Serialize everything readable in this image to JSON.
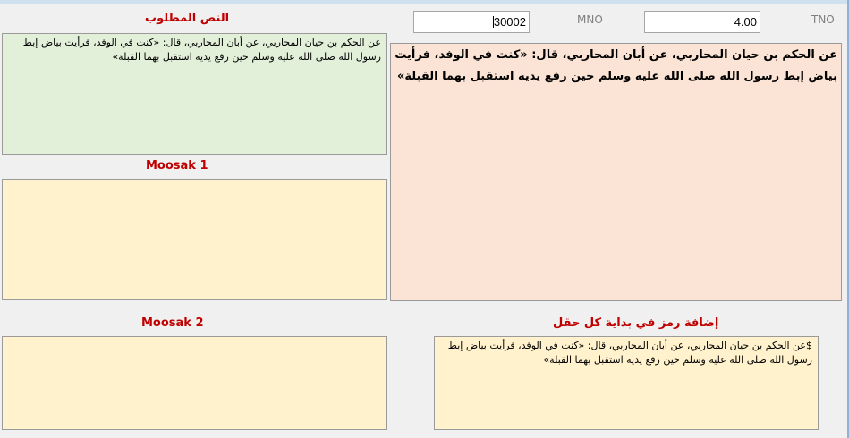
{
  "labels": {
    "required_text": "النص المطلوب",
    "moosak1": "Moosak 1",
    "moosak2": "Moosak 2",
    "add_symbol": "إضافة رمز في بداية كل حقل"
  },
  "fields": {
    "mno_label": "MNO",
    "mno_value": "30002",
    "tno_label": "TNO",
    "tno_value": "4.00"
  },
  "texts": {
    "required_text": "عن الحكم بن حيان المحاربي، عن أبان المحاربي، قال: «كنت في الوفد، فرأيت بياض إبط رسول الله صلى الله عليه وسلم حين رفع يديه استقبل بهما القبلة»",
    "main_text": "عن الحكم بن حيان المحاربي، عن أبان المحاربي، قال: «كنت في الوفد، فرأيت بياض إبط رسول الله صلى الله عليه وسلم حين رفع يديه استقبل بهما القبلة»",
    "moosak1": "",
    "moosak2": "",
    "symbol_text": "$عن الحكم بن حيان المحاربي، عن أبان المحاربي، قال: «كنت في الوفد، فرأيت بياض إبط رسول الله صلى الله عليه وسلم حين رفع يديه استقبل بهما القبلة»"
  }
}
